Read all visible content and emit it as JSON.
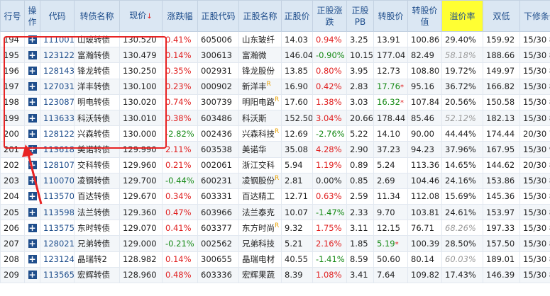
{
  "headers": [
    "行号",
    "操作",
    "代码",
    "转债名称",
    "现价",
    "涨跌幅",
    "正股代码",
    "正股名称",
    "正股价",
    "正股涨跌",
    "正股PB",
    "转股价",
    "转股价值",
    "溢价率",
    "双低",
    "下修条件"
  ],
  "sort_arrow": "↓",
  "plus_symbol": "+",
  "rows": [
    {
      "row": "194",
      "code": "111001",
      "name": "山玻转债",
      "price": "130.520",
      "change": "0.41%",
      "stock_code": "605006",
      "stock_name": "山东玻纤",
      "stock_badge": "",
      "stock_price": "14.03",
      "stock_change": "0.94%",
      "pb": "3.25",
      "conv_price": "13.91",
      "conv_star": "",
      "conv_value": "100.86",
      "premium": "29.40%",
      "double_low": "159.92",
      "clause": "15/30 85%"
    },
    {
      "row": "195",
      "code": "123122",
      "name": "富瀚转债",
      "price": "130.479",
      "change": "0.14%",
      "stock_code": "300613",
      "stock_name": "富瀚微",
      "stock_badge": "",
      "stock_price": "146.04",
      "stock_change": "-0.90%",
      "pb": "10.15",
      "conv_price": "177.04",
      "conv_star": "",
      "conv_value": "82.49",
      "premium": "58.18%",
      "double_low": "188.66",
      "clause": "15/30 85%"
    },
    {
      "row": "196",
      "code": "128143",
      "name": "锋龙转债",
      "price": "130.250",
      "change": "0.35%",
      "stock_code": "002931",
      "stock_name": "锋龙股份",
      "stock_badge": "",
      "stock_price": "13.85",
      "stock_change": "0.80%",
      "pb": "3.95",
      "conv_price": "12.73",
      "conv_star": "",
      "conv_value": "108.80",
      "premium": "19.72%",
      "double_low": "149.97",
      "clause": "15/30 85%"
    },
    {
      "row": "197",
      "code": "127031",
      "name": "洋丰转债",
      "price": "130.100",
      "change": "0.23%",
      "stock_code": "000902",
      "stock_name": "新洋丰",
      "stock_badge": "R",
      "stock_price": "16.90",
      "stock_change": "0.42%",
      "pb": "2.83",
      "conv_price": "17.76",
      "conv_star": "*",
      "conv_value": "95.16",
      "premium": "36.72%",
      "double_low": "166.82",
      "clause": "15/30 85%"
    },
    {
      "row": "198",
      "code": "123087",
      "name": "明电转债",
      "price": "130.020",
      "change": "0.74%",
      "stock_code": "300739",
      "stock_name": "明阳电路",
      "stock_badge": "R",
      "stock_price": "17.60",
      "stock_change": "1.38%",
      "pb": "3.03",
      "conv_price": "16.32",
      "conv_star": "*",
      "conv_value": "107.84",
      "premium": "20.56%",
      "double_low": "150.58",
      "clause": "15/30 85%"
    },
    {
      "row": "199",
      "code": "113633",
      "name": "科沃转债",
      "price": "130.010",
      "change": "0.38%",
      "stock_code": "603486",
      "stock_name": "科沃斯",
      "stock_badge": "",
      "stock_price": "152.50",
      "stock_change": "3.04%",
      "pb": "20.66",
      "conv_price": "178.44",
      "conv_star": "",
      "conv_value": "85.46",
      "premium": "52.12%",
      "double_low": "182.13",
      "clause": "15/30 85%"
    },
    {
      "row": "200",
      "code": "128122",
      "name": "兴森转债",
      "price": "130.000",
      "change": "-2.82%",
      "stock_code": "002436",
      "stock_name": "兴森科技",
      "stock_badge": "R",
      "stock_price": "12.69",
      "stock_change": "-2.76%",
      "pb": "5.22",
      "conv_price": "14.10",
      "conv_star": "",
      "conv_value": "90.00",
      "premium": "44.44%",
      "double_low": "174.44",
      "clause": "20/30 70%"
    },
    {
      "row": "201",
      "code": "113618",
      "name": "美诺转债",
      "price": "129.990",
      "change": "2.11%",
      "stock_code": "603538",
      "stock_name": "美诺华",
      "stock_badge": "",
      "stock_price": "35.08",
      "stock_change": "4.28%",
      "pb": "2.90",
      "conv_price": "37.23",
      "conv_star": "",
      "conv_value": "94.23",
      "premium": "37.96%",
      "double_low": "167.95",
      "clause": "15/30 90%"
    },
    {
      "row": "202",
      "code": "128107",
      "name": "交科转债",
      "price": "129.960",
      "change": "0.21%",
      "stock_code": "002061",
      "stock_name": "浙江交科",
      "stock_badge": "",
      "stock_price": "5.94",
      "stock_change": "1.19%",
      "pb": "0.89",
      "conv_price": "5.24",
      "conv_star": "",
      "conv_value": "113.36",
      "premium": "14.65%",
      "double_low": "144.62",
      "clause": "20/30 85%"
    },
    {
      "row": "203",
      "code": "110070",
      "name": "凌钢转债",
      "price": "129.700",
      "change": "-0.44%",
      "stock_code": "600231",
      "stock_name": "凌钢股份",
      "stock_badge": "R",
      "stock_price": "2.81",
      "stock_change": "0.00%",
      "pb": "0.85",
      "conv_price": "2.69",
      "conv_star": "",
      "conv_value": "104.46",
      "premium": "24.16%",
      "double_low": "153.86",
      "clause": "15/30 85%"
    },
    {
      "row": "204",
      "code": "113570",
      "name": "百达转债",
      "price": "129.670",
      "change": "0.34%",
      "stock_code": "603331",
      "stock_name": "百达精工",
      "stock_badge": "",
      "stock_price": "12.71",
      "stock_change": "0.63%",
      "pb": "2.59",
      "conv_price": "11.34",
      "conv_star": "",
      "conv_value": "112.08",
      "premium": "15.69%",
      "double_low": "145.36",
      "clause": "15/30 85%"
    },
    {
      "row": "205",
      "code": "113598",
      "name": "法兰转债",
      "price": "129.360",
      "change": "0.47%",
      "stock_code": "603966",
      "stock_name": "法兰泰克",
      "stock_badge": "",
      "stock_price": "10.07",
      "stock_change": "-1.47%",
      "pb": "2.33",
      "conv_price": "9.70",
      "conv_star": "",
      "conv_value": "103.81",
      "premium": "24.61%",
      "double_low": "153.97",
      "clause": "15/30 80%"
    },
    {
      "row": "206",
      "code": "113575",
      "name": "东时转债",
      "price": "129.070",
      "change": "0.41%",
      "stock_code": "603377",
      "stock_name": "东方时尚",
      "stock_badge": "R",
      "stock_price": "9.32",
      "stock_change": "1.75%",
      "pb": "3.11",
      "conv_price": "12.15",
      "conv_star": "",
      "conv_value": "76.71",
      "premium": "68.26%",
      "double_low": "197.33",
      "clause": "15/30 85%"
    },
    {
      "row": "207",
      "code": "128021",
      "name": "兄弟转债",
      "price": "129.000",
      "change": "-0.21%",
      "stock_code": "002562",
      "stock_name": "兄弟科技",
      "stock_badge": "",
      "stock_price": "5.21",
      "stock_change": "2.16%",
      "pb": "1.85",
      "conv_price": "5.19",
      "conv_star": "*",
      "conv_value": "100.39",
      "premium": "28.50%",
      "double_low": "157.50",
      "clause": "15/30 85%"
    },
    {
      "row": "208",
      "code": "123124",
      "name": "晶瑞转2",
      "price": "128.982",
      "change": "0.14%",
      "stock_code": "300655",
      "stock_name": "晶瑞电材",
      "stock_badge": "",
      "stock_price": "40.55",
      "stock_change": "-1.41%",
      "pb": "8.59",
      "conv_price": "50.60",
      "conv_star": "",
      "conv_value": "80.14",
      "premium": "60.03%",
      "double_low": "189.01",
      "clause": "15/30 85%"
    },
    {
      "row": "209",
      "code": "113565",
      "name": "宏辉转债",
      "price": "128.960",
      "change": "0.48%",
      "stock_code": "603336",
      "stock_name": "宏辉果蔬",
      "stock_badge": "",
      "stock_price": "8.39",
      "stock_change": "1.08%",
      "pb": "3.41",
      "conv_price": "7.64",
      "conv_star": "",
      "conv_value": "109.82",
      "premium": "17.43%",
      "double_low": "146.39",
      "clause": "15/30 85%"
    }
  ]
}
